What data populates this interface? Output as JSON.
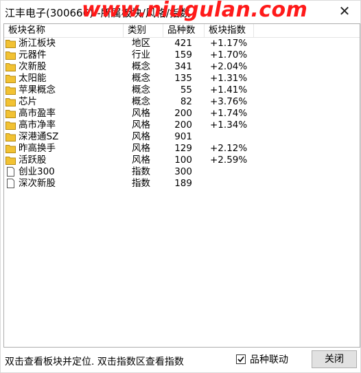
{
  "window": {
    "title": "江丰电子(300666)--所属板块/风格/指数",
    "watermark": "www.niugulan.com"
  },
  "table": {
    "headers": [
      "板块名称",
      "类别",
      "品种数",
      "板块指数"
    ],
    "rows": [
      {
        "name": "浙江板块",
        "category": "地区",
        "count": "421",
        "index": "+1.17%",
        "icon": "folder-icon"
      },
      {
        "name": "元器件",
        "category": "行业",
        "count": "159",
        "index": "+1.70%",
        "icon": "folder-icon"
      },
      {
        "name": "次新股",
        "category": "概念",
        "count": "341",
        "index": "+2.04%",
        "icon": "folder-icon"
      },
      {
        "name": "太阳能",
        "category": "概念",
        "count": "135",
        "index": "+1.31%",
        "icon": "folder-icon"
      },
      {
        "name": "苹果概念",
        "category": "概念",
        "count": "55",
        "index": "+1.41%",
        "icon": "folder-icon"
      },
      {
        "name": "芯片",
        "category": "概念",
        "count": "82",
        "index": "+3.76%",
        "icon": "folder-icon"
      },
      {
        "name": "高市盈率",
        "category": "风格",
        "count": "200",
        "index": "+1.74%",
        "icon": "folder-icon"
      },
      {
        "name": "高市净率",
        "category": "风格",
        "count": "200",
        "index": "+1.34%",
        "icon": "folder-icon"
      },
      {
        "name": "深港通SZ",
        "category": "风格",
        "count": "901",
        "index": "",
        "icon": "folder-icon"
      },
      {
        "name": "昨高换手",
        "category": "风格",
        "count": "129",
        "index": "+2.12%",
        "icon": "folder-icon"
      },
      {
        "name": "活跃股",
        "category": "风格",
        "count": "100",
        "index": "+2.59%",
        "icon": "folder-icon"
      },
      {
        "name": "创业300",
        "category": "指数",
        "count": "300",
        "index": "",
        "icon": "document-icon"
      },
      {
        "name": "深次新股",
        "category": "指数",
        "count": "189",
        "index": "",
        "icon": "document-icon"
      }
    ]
  },
  "status": {
    "hint": "双击查看板块并定位. 双击指数区查看指数",
    "checkbox_label": "品种联动",
    "checkbox_checked": true,
    "close_label": "关闭"
  },
  "colors": {
    "folder": "#f2c233",
    "folder_edge": "#b58a12",
    "watermark": "#ff1a1a"
  }
}
